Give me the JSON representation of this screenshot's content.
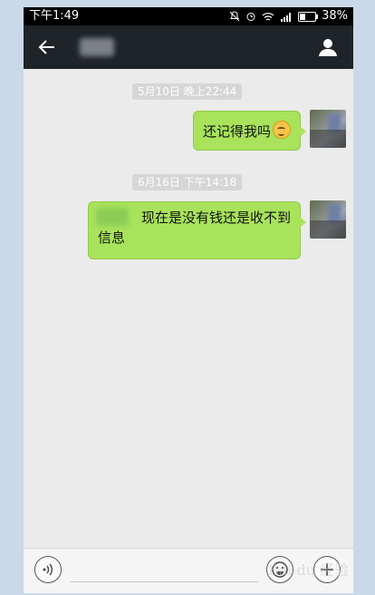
{
  "status_bar": {
    "time": "下午1:49",
    "battery": "38%",
    "battery_level": 0.38
  },
  "header": {
    "back_icon": "arrow-left-icon",
    "profile_icon": "person-icon"
  },
  "messages": [
    {
      "timestamp": "5月10日 晚上22:44",
      "text": "还记得我吗",
      "emoji": "smiling-face-icon",
      "from": "self"
    },
    {
      "timestamp": "6月16日 下午14:18",
      "text": "现在是没有钱还是收不到信息",
      "from": "self"
    }
  ],
  "input_bar": {
    "voice_icon": "voice-wave-icon",
    "emoji_icon": "smiley-icon",
    "plus_icon": "plus-icon",
    "watermark": "Bai du 经验"
  },
  "colors": {
    "bubble": "#a8e35b",
    "header": "#1f2428",
    "background": "#ebebeb"
  }
}
